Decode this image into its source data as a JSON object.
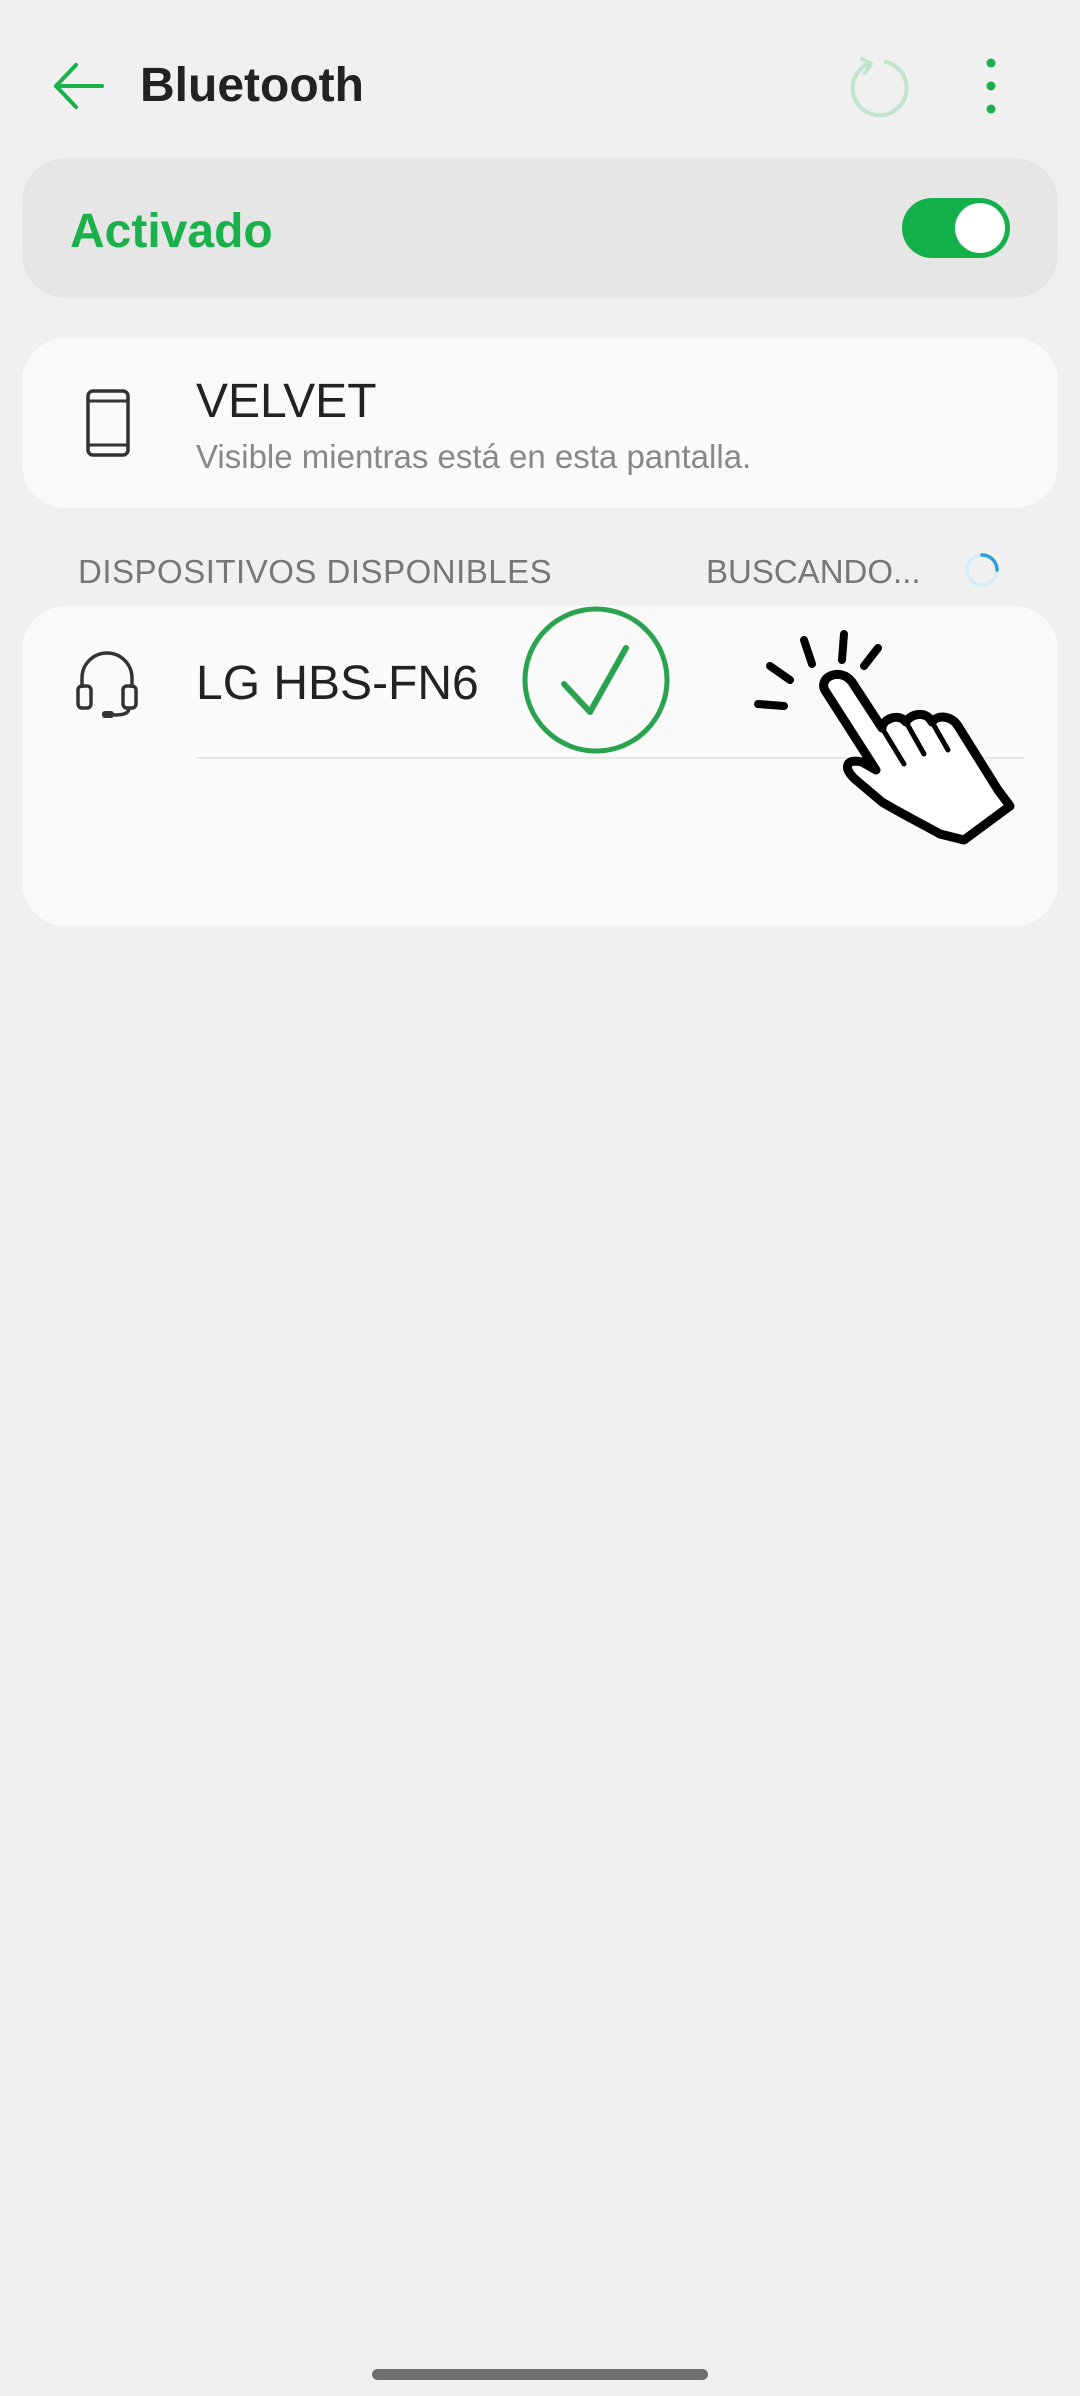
{
  "header": {
    "title": "Bluetooth",
    "back_icon": "arrow-left-icon",
    "refresh_icon": "refresh-icon",
    "more_icon": "more-vert-icon"
  },
  "bluetooth_toggle": {
    "label": "Activado",
    "state": "on"
  },
  "this_device": {
    "name": "VELVET",
    "subtitle": "Visible mientras está en esta pantalla.",
    "icon": "phone-icon"
  },
  "available": {
    "section_title": "DISPOSITIVOS DISPONIBLES",
    "status": "BUSCANDO...",
    "items": [
      {
        "label": "LG HBS-FN6",
        "icon": "headset-icon"
      }
    ]
  },
  "overlay": {
    "check_icon": "checkmark-circle-icon",
    "hand_icon": "tap-hand-icon"
  },
  "colors": {
    "accent": "#1ab04a",
    "background": "#f0f0f0",
    "card": "#fafafa",
    "toggle_card": "#e6e6e6",
    "spinner": "#2aa0d6"
  }
}
